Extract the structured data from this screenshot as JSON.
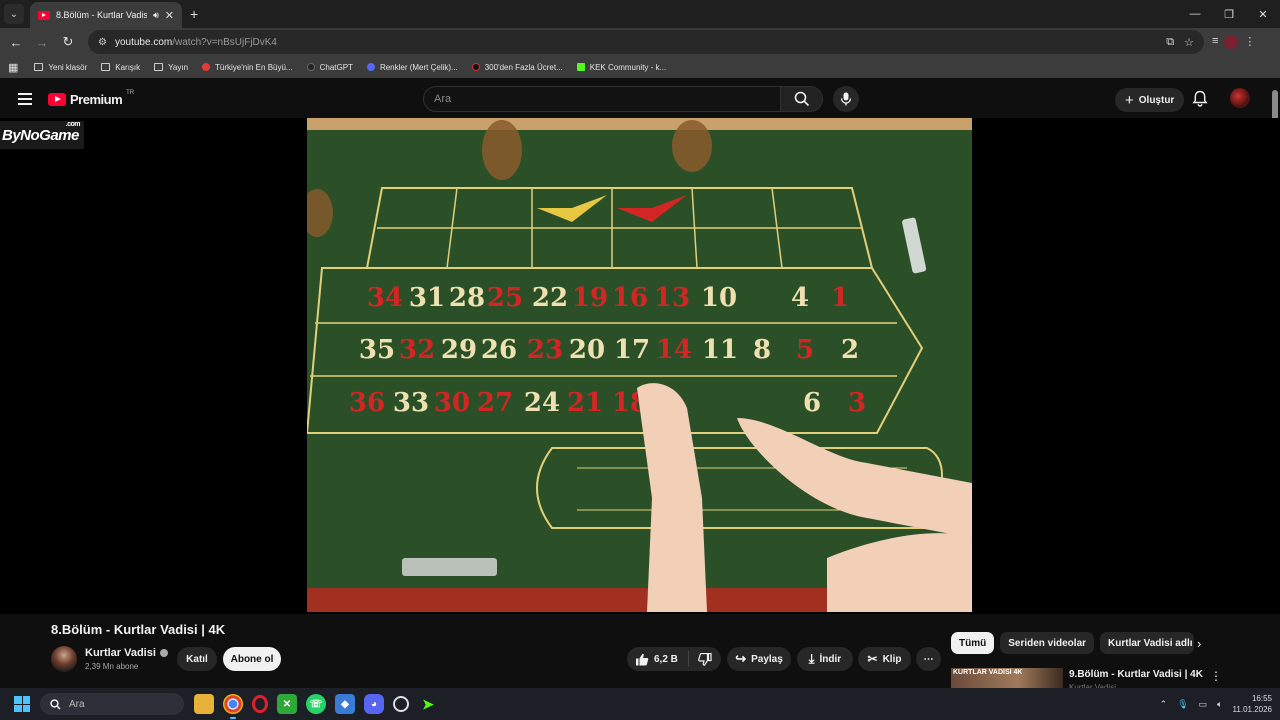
{
  "browser": {
    "tab_title": "8.Bölüm - Kurtlar Vadisi | 4K",
    "url_host": "youtube.com",
    "url_path": "/watch?v=nBsUjFjDvK4",
    "bookmarks": [
      {
        "label": "Yeni klasör",
        "icon": "folder-icon"
      },
      {
        "label": "Karışık",
        "icon": "folder-icon"
      },
      {
        "label": "Yayın",
        "icon": "folder-icon"
      },
      {
        "label": "Türkiye'nin En Büyü...",
        "icon": "site-icon",
        "color": "#e53935"
      },
      {
        "label": "ChatGPT",
        "icon": "chatgpt-icon",
        "color": "#222222"
      },
      {
        "label": "Renkler (Mert Çelik)...",
        "icon": "discord-icon",
        "color": "#5865f2"
      },
      {
        "label": "300'den Fazla Ücret...",
        "icon": "site-icon",
        "color": "#111111"
      },
      {
        "label": "KEK Community - k...",
        "icon": "kick-icon",
        "color": "#53fc18"
      }
    ]
  },
  "youtube": {
    "logo_text": "Premium",
    "logo_region": "TR",
    "search_placeholder": "Ara",
    "create_label": "Oluştur"
  },
  "video": {
    "watermark": "ByNoGame",
    "watermark_suffix": ".com",
    "title": "8.Bölüm - Kurtlar Vadisi | 4K",
    "channel_name": "Kurtlar Vadisi",
    "subscribers": "2,39 Mn abone",
    "join_label": "Katıl",
    "subscribe_label": "Abone ol",
    "like_count": "6,2 B",
    "share_label": "Paylaş",
    "download_label": "İndir",
    "clip_label": "Klip"
  },
  "sidebar": {
    "chips": [
      "Tümü",
      "Seriden videolar",
      "Kurtlar Vadisi adlı yük"
    ],
    "rec_title": "9.Bölüm - Kurtlar Vadisi | 4K",
    "rec_channel": "Kurtlar Vadisi",
    "rec_thumb_label": "KURTLAR VADİSİ 4K"
  },
  "taskbar": {
    "search_placeholder": "Ara",
    "time": "16:55",
    "date": "11.01.2026"
  },
  "colors": {
    "felt": "#2b5028",
    "youtube_red": "#ff0033",
    "accent": "#4cc2ff"
  }
}
